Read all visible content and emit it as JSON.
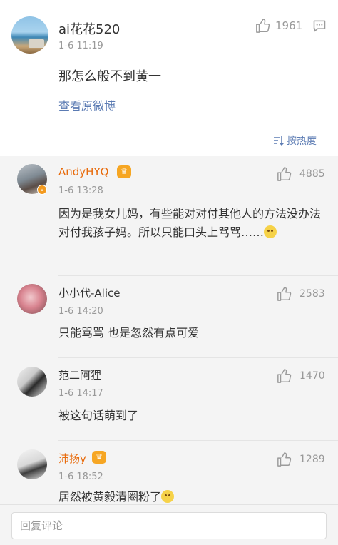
{
  "main_post": {
    "username": "ai花花520",
    "time": "1-6 11:19",
    "likes": "1961",
    "text": "那怎么般不到黄一",
    "view_original": "查看原微博",
    "sort_label": "按热度"
  },
  "replies": [
    {
      "username": "AndyHYQ",
      "vip": true,
      "time": "1-6 13:28",
      "likes": "4885",
      "text": "因为是我女儿妈，有些能对对付其他人的方法没办法对付我孩子妈。所以只能口头上骂骂……"
    },
    {
      "username": "小小代-Alice",
      "vip": false,
      "time": "1-6 14:20",
      "likes": "2583",
      "text": "只能骂骂 也是忽然有点可爱"
    },
    {
      "username": "范二阿狸",
      "vip": false,
      "time": "1-6 14:17",
      "likes": "1470",
      "text": "被这句话萌到了"
    },
    {
      "username": "沛扬y",
      "vip": true,
      "time": "1-6 18:52",
      "likes": "1289",
      "text": "居然被黄毅清圈粉了"
    }
  ],
  "bottom_bar": {
    "reply_placeholder": "回复评论"
  },
  "colors": {
    "link": "#5b7bb3",
    "vip_name": "#e86b0c",
    "meta": "#999999",
    "reply_bg": "#f4f4f4"
  },
  "icons": [
    "thumbs-up-icon",
    "comment-icon",
    "sort-icon",
    "crown-icon",
    "verified-badge-icon",
    "emoji-icon"
  ]
}
